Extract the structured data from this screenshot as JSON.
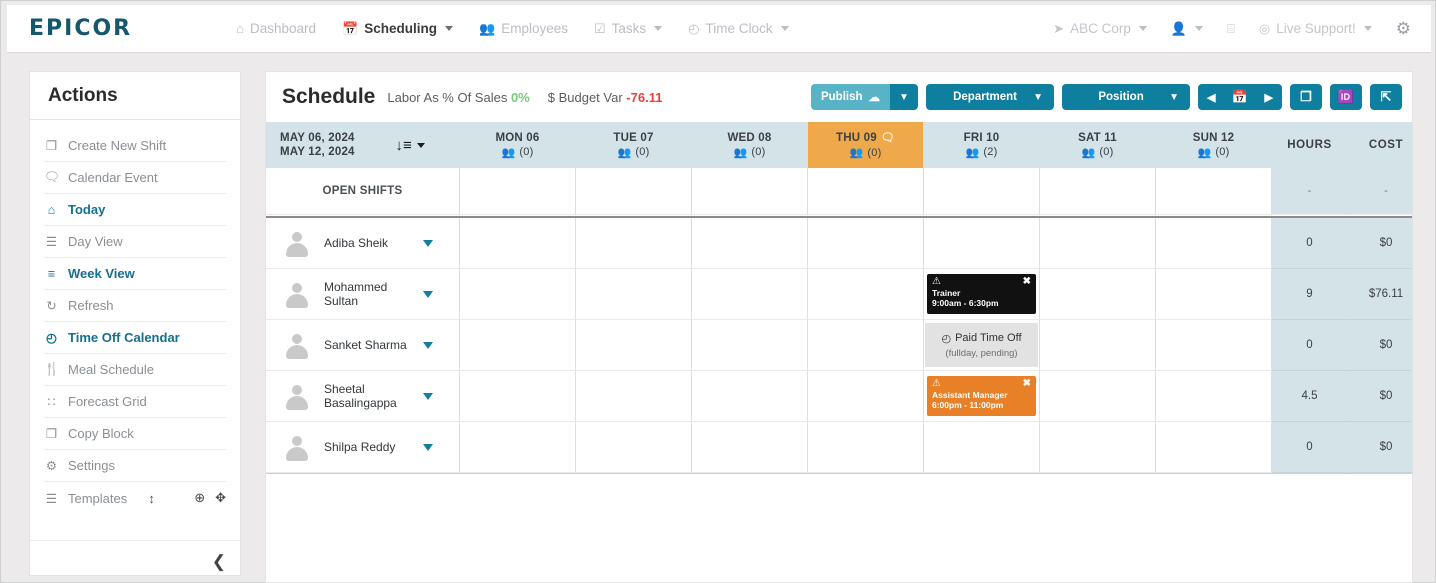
{
  "topnav": {
    "logo": "EPICOR",
    "items": [
      {
        "label": "Dashboard",
        "icon": "home-icon",
        "caret": false,
        "active": false
      },
      {
        "label": "Scheduling",
        "icon": "calendar-icon",
        "caret": true,
        "active": true
      },
      {
        "label": "Employees",
        "icon": "people-icon",
        "caret": false,
        "active": false
      },
      {
        "label": "Tasks",
        "icon": "checkbox-icon",
        "caret": true,
        "active": false
      },
      {
        "label": "Time Clock",
        "icon": "clock-icon",
        "caret": true,
        "active": false
      }
    ],
    "right": [
      {
        "label": "ABC Corp",
        "icon": "send-icon",
        "caret": true
      },
      {
        "label": "",
        "icon": "user-icon",
        "caret": true
      },
      {
        "label": "",
        "icon": "message-icon",
        "caret": false
      },
      {
        "label": "Live Support!",
        "icon": "headset-icon",
        "caret": true
      }
    ],
    "settings_icon": "gear-icon"
  },
  "sidebar": {
    "title": "Actions",
    "items": [
      {
        "label": "Create New Shift",
        "icon": "copy-shift-icon",
        "accent": false
      },
      {
        "label": "Calendar Event",
        "icon": "comment-icon",
        "accent": false
      },
      {
        "label": "Today",
        "icon": "home-icon",
        "accent": true
      },
      {
        "label": "Day View",
        "icon": "list-icon",
        "accent": false
      },
      {
        "label": "Week View",
        "icon": "bars-icon",
        "accent": true
      },
      {
        "label": "Refresh",
        "icon": "refresh-icon",
        "accent": false
      },
      {
        "label": "Time Off Calendar",
        "icon": "clock-icon",
        "accent": true
      },
      {
        "label": "Meal Schedule",
        "icon": "cutlery-icon",
        "accent": false
      },
      {
        "label": "Forecast Grid",
        "icon": "grid-icon",
        "accent": false
      },
      {
        "label": "Copy Block",
        "icon": "clone-icon",
        "accent": false
      },
      {
        "label": "Settings",
        "icon": "cogs-icon",
        "accent": false
      },
      {
        "label": "Templates",
        "icon": "template-icon",
        "accent": false
      }
    ],
    "templates_extras": [
      "add-circle-icon",
      "expand-arrows-icon"
    ],
    "templates_sort_icon": "vertical-arrows-icon",
    "collapse_icon": "chevron-left-icon"
  },
  "schedule": {
    "title": "Schedule",
    "kpis": [
      {
        "label": "Labor As % Of Sales",
        "value": "0%",
        "color": "#79c97d"
      },
      {
        "label": "$ Budget Var",
        "value": "-76.11",
        "color": "#e8433a"
      }
    ],
    "buttons": {
      "publish": "Publish",
      "publish_icon": "cloud-upload-icon",
      "department": "Department",
      "position": "Position",
      "prev_icon": "caret-left-icon",
      "calendar_icon": "calendar-icon",
      "next_icon": "caret-right-icon",
      "copy_icon": "clone-icon",
      "excel_icon": "excel-export-icon",
      "fullscreen_icon": "expand-icon"
    }
  },
  "grid": {
    "date_range": {
      "start": "MAY 06, 2024",
      "end": "MAY 12, 2024"
    },
    "sort_icon": "sort-amount-desc-icon",
    "days": [
      {
        "label": "MON 06",
        "count": "(0)",
        "today": false,
        "comment": false
      },
      {
        "label": "TUE 07",
        "count": "(0)",
        "today": false,
        "comment": false
      },
      {
        "label": "WED 08",
        "count": "(0)",
        "today": false,
        "comment": false
      },
      {
        "label": "THU 09",
        "count": "(0)",
        "today": true,
        "comment": true
      },
      {
        "label": "FRI 10",
        "count": "(2)",
        "today": false,
        "comment": false
      },
      {
        "label": "SAT 11",
        "count": "(0)",
        "today": false,
        "comment": false
      },
      {
        "label": "SUN 12",
        "count": "(0)",
        "today": false,
        "comment": false
      }
    ],
    "summary_headers": [
      "HOURS",
      "COST"
    ],
    "open_shifts": {
      "label": "OPEN SHIFTS",
      "hours": "-",
      "cost": "-"
    },
    "rows": [
      {
        "name": "Adiba Sheik",
        "hours": "0",
        "cost": "$0",
        "shift": null
      },
      {
        "name": "Mohammed Sultan",
        "hours": "9",
        "cost": "$76.11",
        "shift": {
          "day": 4,
          "kind": "shift",
          "style": "dark",
          "role": "Trainer",
          "time": "9:00am - 6:30pm",
          "warn_icon": "warning-icon",
          "close_icon": "close-icon"
        }
      },
      {
        "name": "Sanket Sharma",
        "hours": "0",
        "cost": "$0",
        "shift": {
          "day": 4,
          "kind": "pto",
          "title": "Paid Time Off",
          "sub": "(fullday, pending)",
          "icon": "clock-icon"
        }
      },
      {
        "name": "Sheetal Basalingappa",
        "hours": "4.5",
        "cost": "$0",
        "shift": {
          "day": 4,
          "kind": "shift",
          "style": "orange",
          "role": "Assistant Manager",
          "time": "6:00pm - 11:00pm",
          "warn_icon": "warning-icon",
          "close_icon": "close-icon"
        }
      },
      {
        "name": "Shilpa Reddy",
        "hours": "0",
        "cost": "$0",
        "shift": null
      }
    ]
  }
}
